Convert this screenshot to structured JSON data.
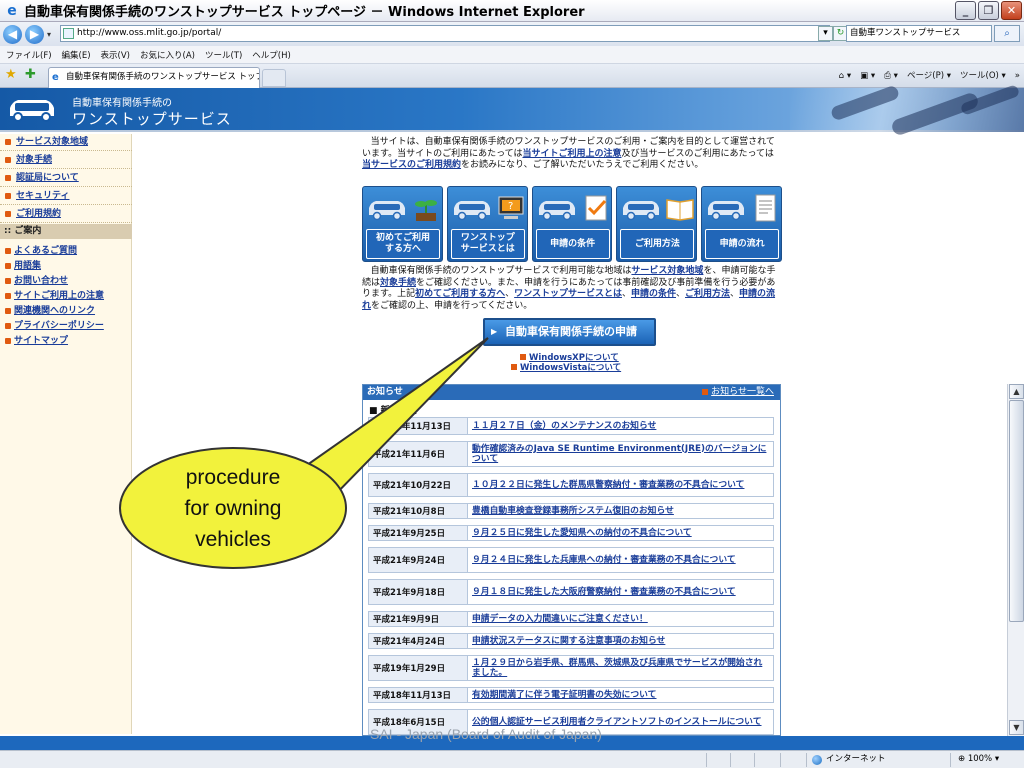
{
  "window": {
    "title": "自動車保有関係手続のワンストップサービス トップページ － Windows Internet Explorer"
  },
  "addressbar": {
    "url": "http://www.oss.mlit.go.jp/portal/",
    "search_value": "自動車ワンストップサービス"
  },
  "menubar": [
    "ファイル(F)",
    "編集(E)",
    "表示(V)",
    "お気に入り(A)",
    "ツール(T)",
    "ヘルプ(H)"
  ],
  "tabbar": {
    "tab_label": "自動車保有関係手続のワンストップサービス トップ...",
    "commands": [
      "ページ(P) ▾",
      "ツール(O) ▾",
      "»"
    ]
  },
  "header": {
    "subtitle": "自動車保有関係手続の",
    "title": "ワンストップサービス"
  },
  "sidebar": {
    "items": [
      "サービス対象地域",
      "対象手続",
      "認証局について",
      "セキュリティ",
      "ご利用規約"
    ],
    "category": "ご案内",
    "subitems": [
      "よくあるご質問",
      "用語集",
      "お問い合わせ",
      "サイトご利用上の注意",
      "関連機関へのリンク",
      "プライバシーポリシー",
      "サイトマップ"
    ]
  },
  "intro": {
    "p1": "当サイトは、自動車保有関係手続のワンストップサービスのご利用・ご案内を目的として運営されています。当サイトのご利用にあたっては",
    "l1": "当サイトご利用上の注意",
    "p2": "及び当サービスのご利用にあたっては",
    "l2": "当サービスのご利用規約",
    "p3": "をお読みになり、ご了解いただいたうえでご利用ください。"
  },
  "navcards": [
    {
      "label": "初めてご利用\nする方へ",
      "icon": "sprout-icon"
    },
    {
      "label": "ワンストップ\nサービスとは",
      "icon": "computer-icon"
    },
    {
      "label": "申請の条件",
      "icon": "checklist-icon"
    },
    {
      "label": "ご利用方法",
      "icon": "book-icon"
    },
    {
      "label": "申請の流れ",
      "icon": "document-icon"
    }
  ],
  "para2": {
    "t1": "自動車保有関係手続のワンストップサービスで利用可能な地域は",
    "l1": "サービス対象地域",
    "t2": "を、申請可能な手続は",
    "l2": "対象手続",
    "t3": "をご確認ください。また、申請を行うにあたっては事前確認及び事前準備を行う必要があります。上記",
    "l3": "初めてご利用する方へ",
    "t4": "、",
    "l4": "ワンストップサービスとは",
    "t5": "、",
    "l5": "申請の条件",
    "t6": "、",
    "l6": "ご利用方法",
    "t7": "、",
    "l7": "申請の流れ",
    "t8": "をご確認の上、申請を行ってください。"
  },
  "apply_button": "自動車保有関係手続の申請",
  "os_links": [
    "WindowsXPについて",
    "WindowsVistaについて"
  ],
  "news": {
    "heading": "お知らせ",
    "all_link": "お知らせ一覧へ",
    "subheading": "新着情報",
    "rows": [
      {
        "date": "平成21年11月13日",
        "text": "１１月２７日（金）のメンテナンスのお知らせ"
      },
      {
        "date": "平成21年11月6日",
        "text": "動作確認済みのJava SE Runtime Environment(JRE)のバージョンについて"
      },
      {
        "date": "平成21年10月22日",
        "text": "１０月２２日に発生した群馬県警察納付・審査業務の不具合について"
      },
      {
        "date": "平成21年10月8日",
        "text": "豊橋自動車検査登録事務所システム復旧のお知らせ"
      },
      {
        "date": "平成21年9月25日",
        "text": "９月２５日に発生した愛知県への納付の不具合について"
      },
      {
        "date": "平成21年9月24日",
        "text": "９月２４日に発生した兵庫県への納付・審査業務の不具合について"
      },
      {
        "date": "平成21年9月18日",
        "text": "９月１８日に発生した大阪府警察納付・審査業務の不具合について"
      },
      {
        "date": "平成21年9月9日",
        "text": "申請データの入力間違いにご注意ください！"
      },
      {
        "date": "平成21年4月24日",
        "text": "申請状況ステータスに関する注意事項のお知らせ"
      },
      {
        "date": "平成19年1月29日",
        "text": "１月２９日から岩手県、群馬県、茨城県及び兵庫県でサービスが開始されました。"
      },
      {
        "date": "平成18年11月13日",
        "text": "有効期間満了に伴う電子証明書の失効について"
      },
      {
        "date": "平成18年6月15日",
        "text": "公的個人認証サービス利用者クライアントソフトのインストールについて"
      }
    ]
  },
  "watermark": "SAI - Japan (Board of Audit of Japan)",
  "status": {
    "zone": "インターネット",
    "zoom": "100%"
  },
  "callout": {
    "text": "procedure\nfor owning\nvehicles"
  }
}
